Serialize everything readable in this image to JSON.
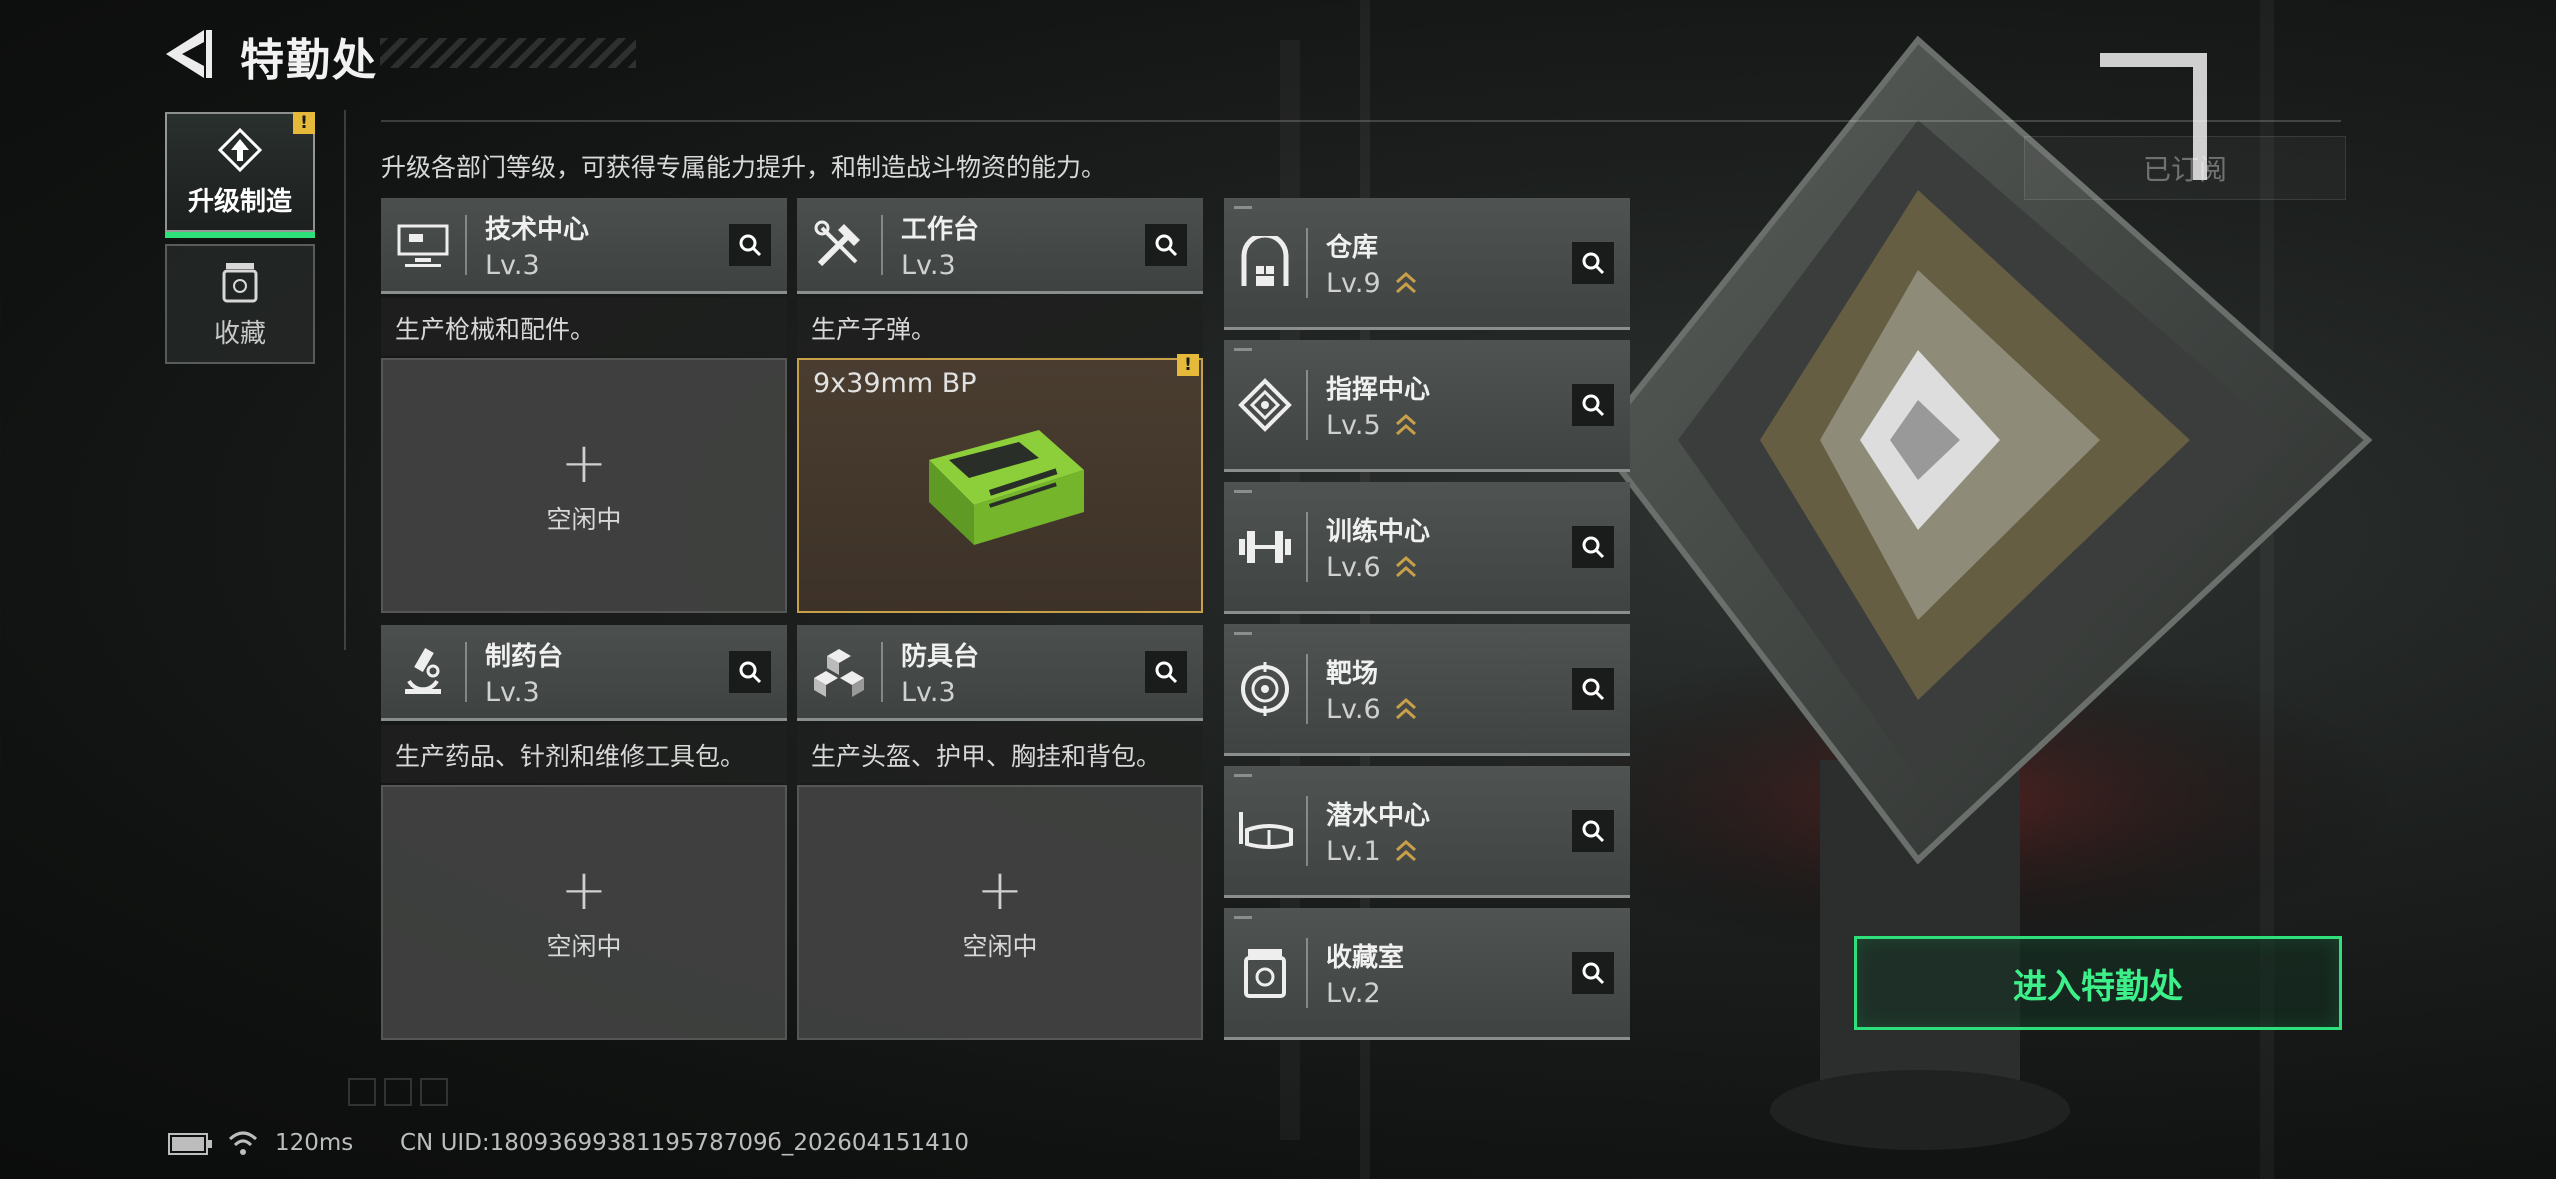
{
  "header": {
    "title": "特勤处",
    "subscribe_label": "已订阅"
  },
  "sidebar": {
    "tabs": [
      {
        "label": "升级制造",
        "active": true,
        "warning": "!"
      },
      {
        "label": "收藏",
        "active": false
      }
    ]
  },
  "main": {
    "description": "升级各部门等级，可获得专属能力提升，和制造战斗物资的能力。",
    "facilities": [
      {
        "name": "技术中心",
        "level": "Lv.3",
        "icon": "monitor-icon",
        "desc": "生产枪械和配件。",
        "slot": {
          "state": "idle",
          "text": "空闲中"
        }
      },
      {
        "name": "工作台",
        "level": "Lv.3",
        "icon": "tools-icon",
        "desc": "生产子弹。",
        "slot": {
          "state": "busy",
          "item": "9x39mm BP",
          "warning": "!"
        }
      },
      {
        "name": "制药台",
        "level": "Lv.3",
        "icon": "microscope-icon",
        "desc": "生产药品、针剂和维修工具包。",
        "slot": {
          "state": "idle",
          "text": "空闲中"
        }
      },
      {
        "name": "防具台",
        "level": "Lv.3",
        "icon": "armor-blocks-icon",
        "desc": "生产头盔、护甲、胸挂和背包。",
        "slot": {
          "state": "idle",
          "text": "空闲中"
        }
      }
    ]
  },
  "right_column": [
    {
      "name": "仓库",
      "level": "Lv.9",
      "icon": "warehouse-icon",
      "upgradable": true
    },
    {
      "name": "指挥中心",
      "level": "Lv.5",
      "icon": "command-icon",
      "upgradable": true
    },
    {
      "name": "训练中心",
      "level": "Lv.6",
      "icon": "dumbbell-icon",
      "upgradable": true
    },
    {
      "name": "靶场",
      "level": "Lv.6",
      "icon": "target-icon",
      "upgradable": true
    },
    {
      "name": "潜水中心",
      "level": "Lv.1",
      "icon": "diving-mask-icon",
      "upgradable": true
    },
    {
      "name": "收藏室",
      "level": "Lv.2",
      "icon": "collection-icon",
      "upgradable": false
    }
  ],
  "enter_button_label": "进入特勤处",
  "footer": {
    "ping": "120ms",
    "uid": "CN UID:1809369938119578709б_202604151410"
  },
  "colors": {
    "accent_green": "#2ee07a",
    "warning_yellow": "#e5b93a",
    "upgrade_gold": "#c9a04a",
    "busy_border": "#c9a04a"
  }
}
